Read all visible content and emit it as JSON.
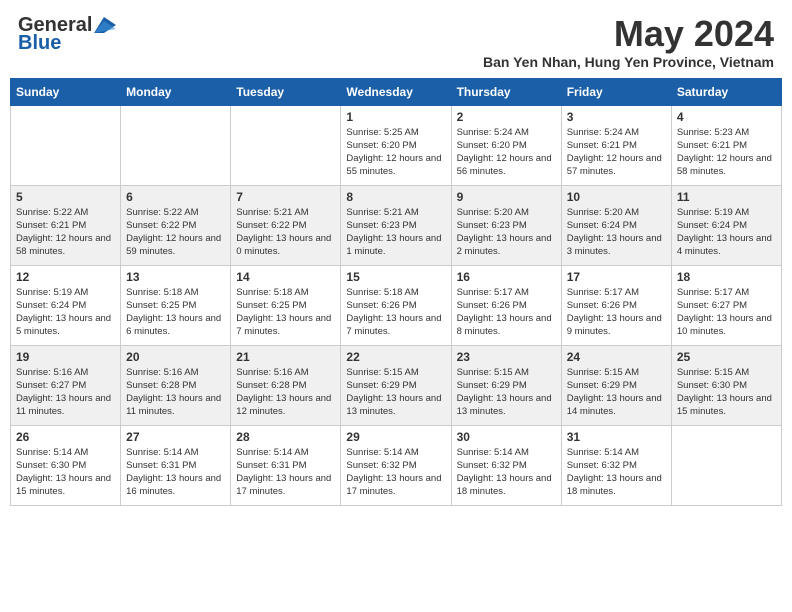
{
  "logo": {
    "general": "General",
    "blue": "Blue"
  },
  "title": "May 2024",
  "location": "Ban Yen Nhan, Hung Yen Province, Vietnam",
  "days_of_week": [
    "Sunday",
    "Monday",
    "Tuesday",
    "Wednesday",
    "Thursday",
    "Friday",
    "Saturday"
  ],
  "weeks": [
    [
      {
        "day": "",
        "info": ""
      },
      {
        "day": "",
        "info": ""
      },
      {
        "day": "",
        "info": ""
      },
      {
        "day": "1",
        "info": "Sunrise: 5:25 AM\nSunset: 6:20 PM\nDaylight: 12 hours and 55 minutes."
      },
      {
        "day": "2",
        "info": "Sunrise: 5:24 AM\nSunset: 6:20 PM\nDaylight: 12 hours and 56 minutes."
      },
      {
        "day": "3",
        "info": "Sunrise: 5:24 AM\nSunset: 6:21 PM\nDaylight: 12 hours and 57 minutes."
      },
      {
        "day": "4",
        "info": "Sunrise: 5:23 AM\nSunset: 6:21 PM\nDaylight: 12 hours and 58 minutes."
      }
    ],
    [
      {
        "day": "5",
        "info": "Sunrise: 5:22 AM\nSunset: 6:21 PM\nDaylight: 12 hours and 58 minutes."
      },
      {
        "day": "6",
        "info": "Sunrise: 5:22 AM\nSunset: 6:22 PM\nDaylight: 12 hours and 59 minutes."
      },
      {
        "day": "7",
        "info": "Sunrise: 5:21 AM\nSunset: 6:22 PM\nDaylight: 13 hours and 0 minutes."
      },
      {
        "day": "8",
        "info": "Sunrise: 5:21 AM\nSunset: 6:23 PM\nDaylight: 13 hours and 1 minute."
      },
      {
        "day": "9",
        "info": "Sunrise: 5:20 AM\nSunset: 6:23 PM\nDaylight: 13 hours and 2 minutes."
      },
      {
        "day": "10",
        "info": "Sunrise: 5:20 AM\nSunset: 6:24 PM\nDaylight: 13 hours and 3 minutes."
      },
      {
        "day": "11",
        "info": "Sunrise: 5:19 AM\nSunset: 6:24 PM\nDaylight: 13 hours and 4 minutes."
      }
    ],
    [
      {
        "day": "12",
        "info": "Sunrise: 5:19 AM\nSunset: 6:24 PM\nDaylight: 13 hours and 5 minutes."
      },
      {
        "day": "13",
        "info": "Sunrise: 5:18 AM\nSunset: 6:25 PM\nDaylight: 13 hours and 6 minutes."
      },
      {
        "day": "14",
        "info": "Sunrise: 5:18 AM\nSunset: 6:25 PM\nDaylight: 13 hours and 7 minutes."
      },
      {
        "day": "15",
        "info": "Sunrise: 5:18 AM\nSunset: 6:26 PM\nDaylight: 13 hours and 7 minutes."
      },
      {
        "day": "16",
        "info": "Sunrise: 5:17 AM\nSunset: 6:26 PM\nDaylight: 13 hours and 8 minutes."
      },
      {
        "day": "17",
        "info": "Sunrise: 5:17 AM\nSunset: 6:26 PM\nDaylight: 13 hours and 9 minutes."
      },
      {
        "day": "18",
        "info": "Sunrise: 5:17 AM\nSunset: 6:27 PM\nDaylight: 13 hours and 10 minutes."
      }
    ],
    [
      {
        "day": "19",
        "info": "Sunrise: 5:16 AM\nSunset: 6:27 PM\nDaylight: 13 hours and 11 minutes."
      },
      {
        "day": "20",
        "info": "Sunrise: 5:16 AM\nSunset: 6:28 PM\nDaylight: 13 hours and 11 minutes."
      },
      {
        "day": "21",
        "info": "Sunrise: 5:16 AM\nSunset: 6:28 PM\nDaylight: 13 hours and 12 minutes."
      },
      {
        "day": "22",
        "info": "Sunrise: 5:15 AM\nSunset: 6:29 PM\nDaylight: 13 hours and 13 minutes."
      },
      {
        "day": "23",
        "info": "Sunrise: 5:15 AM\nSunset: 6:29 PM\nDaylight: 13 hours and 13 minutes."
      },
      {
        "day": "24",
        "info": "Sunrise: 5:15 AM\nSunset: 6:29 PM\nDaylight: 13 hours and 14 minutes."
      },
      {
        "day": "25",
        "info": "Sunrise: 5:15 AM\nSunset: 6:30 PM\nDaylight: 13 hours and 15 minutes."
      }
    ],
    [
      {
        "day": "26",
        "info": "Sunrise: 5:14 AM\nSunset: 6:30 PM\nDaylight: 13 hours and 15 minutes."
      },
      {
        "day": "27",
        "info": "Sunrise: 5:14 AM\nSunset: 6:31 PM\nDaylight: 13 hours and 16 minutes."
      },
      {
        "day": "28",
        "info": "Sunrise: 5:14 AM\nSunset: 6:31 PM\nDaylight: 13 hours and 17 minutes."
      },
      {
        "day": "29",
        "info": "Sunrise: 5:14 AM\nSunset: 6:32 PM\nDaylight: 13 hours and 17 minutes."
      },
      {
        "day": "30",
        "info": "Sunrise: 5:14 AM\nSunset: 6:32 PM\nDaylight: 13 hours and 18 minutes."
      },
      {
        "day": "31",
        "info": "Sunrise: 5:14 AM\nSunset: 6:32 PM\nDaylight: 13 hours and 18 minutes."
      },
      {
        "day": "",
        "info": ""
      }
    ]
  ]
}
